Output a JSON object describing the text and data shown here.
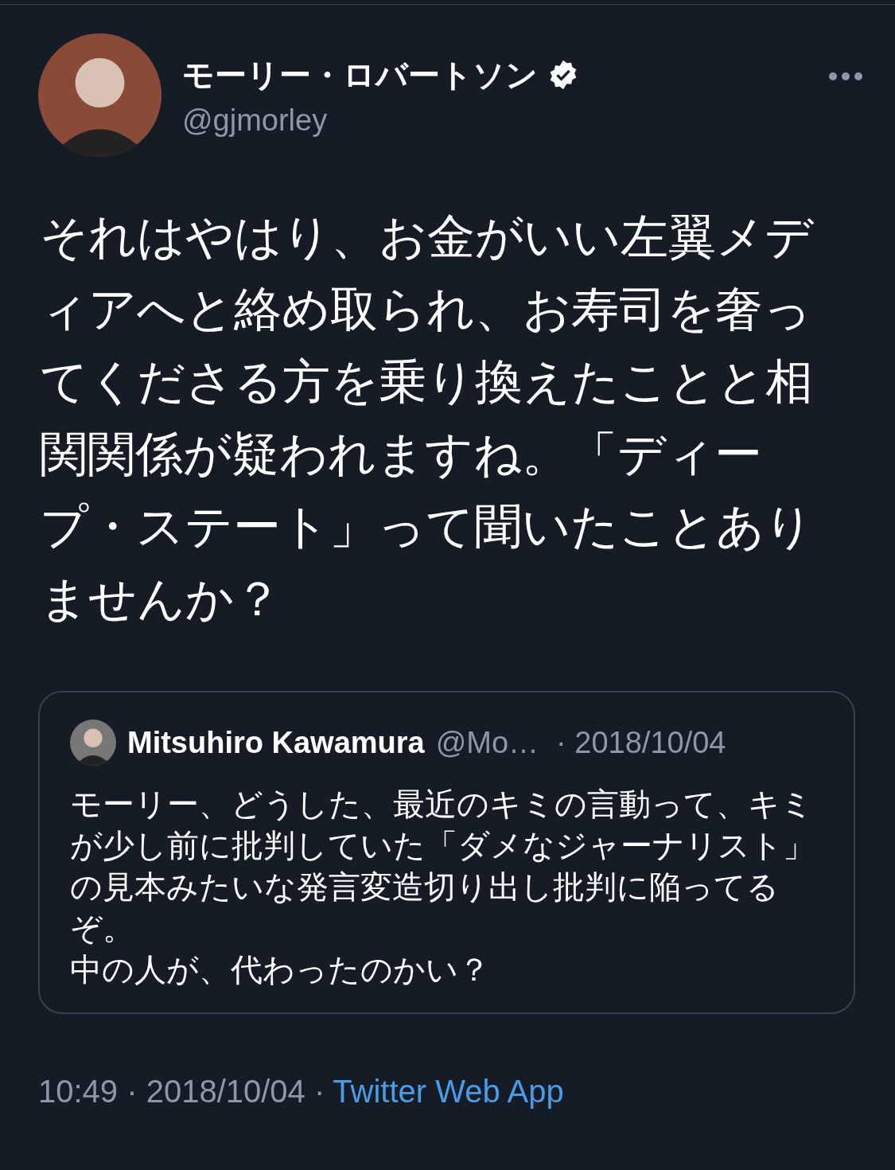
{
  "author": {
    "name": "モーリー・ロバートソン",
    "verified": true,
    "handle": "@gjmorley"
  },
  "text": "それはやはり、お金がいい左翼メディアへと絡め取られ、お寿司を奢ってくださる方を乗り換えたことと相関関係が疑われますね。「ディープ・ステート」って聞いたことありませんか？",
  "quoted_tweet": {
    "name": "Mitsuhiro Kawamura",
    "handle": "@Mo…",
    "date": "· 2018/10/04",
    "paragraphs": [
      "モーリー、どうした、最近のキミの言動って、キミが少し前に批判していた「ダメなジャーナリスト」の見本みたいな発言変造切り出し批判に陥ってるぞ。",
      "中の人が、代わったのかい？"
    ]
  },
  "footer": {
    "timestamp": "10:49 · 2018/10/04 ·",
    "source": "Twitter Web App"
  }
}
